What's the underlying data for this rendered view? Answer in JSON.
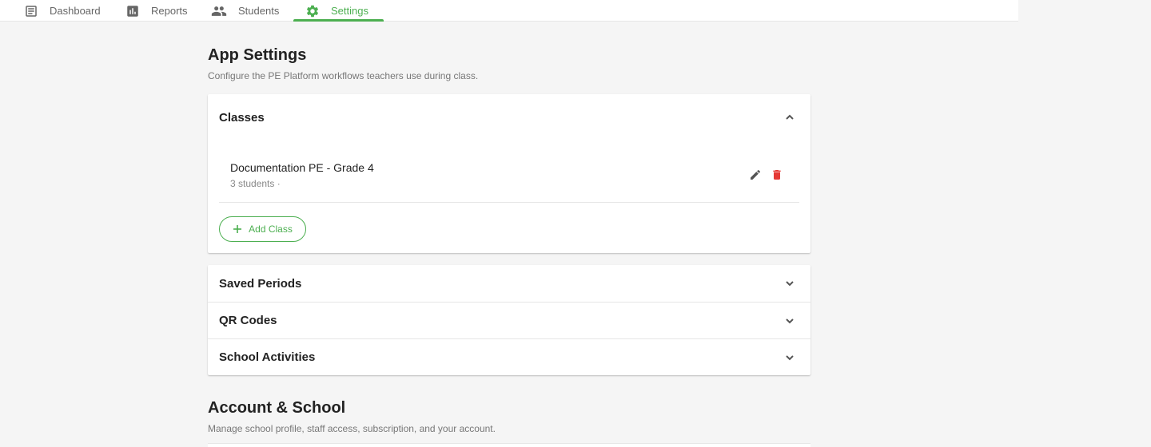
{
  "nav": {
    "items": [
      {
        "label": "Dashboard",
        "icon": "dashboard-icon"
      },
      {
        "label": "Reports",
        "icon": "reports-icon"
      },
      {
        "label": "Students",
        "icon": "students-icon"
      },
      {
        "label": "Settings",
        "icon": "settings-icon"
      }
    ],
    "active": "Settings",
    "accent_color": "#4caf50"
  },
  "app_settings": {
    "title": "App Settings",
    "subtitle": "Configure the PE Platform workflows teachers use during class.",
    "sections": {
      "classes": {
        "title": "Classes",
        "expanded": true,
        "items": [
          {
            "name": "Documentation PE - Grade 4",
            "meta": "3 students ·"
          }
        ],
        "add_label": "Add Class"
      },
      "saved_periods": {
        "title": "Saved Periods",
        "expanded": false
      },
      "qr_codes": {
        "title": "QR Codes",
        "expanded": false
      },
      "school_activities": {
        "title": "School Activities",
        "expanded": false
      }
    }
  },
  "account_school": {
    "title": "Account & School",
    "subtitle": "Manage school profile, staff access, subscription, and your account."
  },
  "colors": {
    "delete": "#e53935",
    "accent": "#4caf50"
  }
}
